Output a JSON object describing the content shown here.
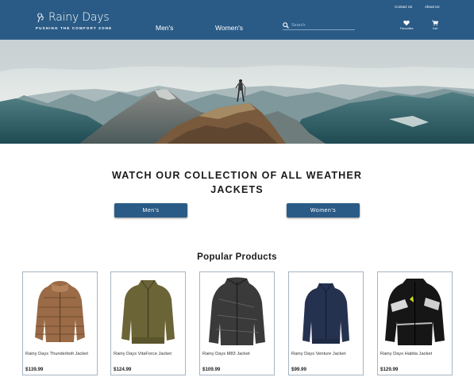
{
  "header": {
    "brand": "Rainy Days",
    "tagline": "Pushing the Comfort Zone",
    "nav": {
      "mens": "Men's",
      "womens": "Women's"
    },
    "search_placeholder": "Search",
    "top_links": {
      "contact": "Contact Us",
      "about": "About Us"
    },
    "favourites_label": "Favourites",
    "cart_label": "Cart",
    "colors": {
      "bar": "#2a5b86"
    }
  },
  "collection": {
    "title": "WATCH OUR COLLECTION OF ALL WEATHER JACKETS",
    "mens_button": "Men's",
    "womens_button": "Women's"
  },
  "popular": {
    "title": "Popular Products",
    "products": [
      {
        "name": "Rainy Days Thunderbolt Jacket",
        "price": "$139.99"
      },
      {
        "name": "Rainy Days VitaForce Jacket",
        "price": "$124.99"
      },
      {
        "name": "Rainy Days M83 Jacket",
        "price": "$109.99"
      },
      {
        "name": "Rainy Days Venture Jacket",
        "price": "$99.99"
      },
      {
        "name": "Rainy Days Habita Jacket",
        "price": "$129.99"
      }
    ]
  }
}
